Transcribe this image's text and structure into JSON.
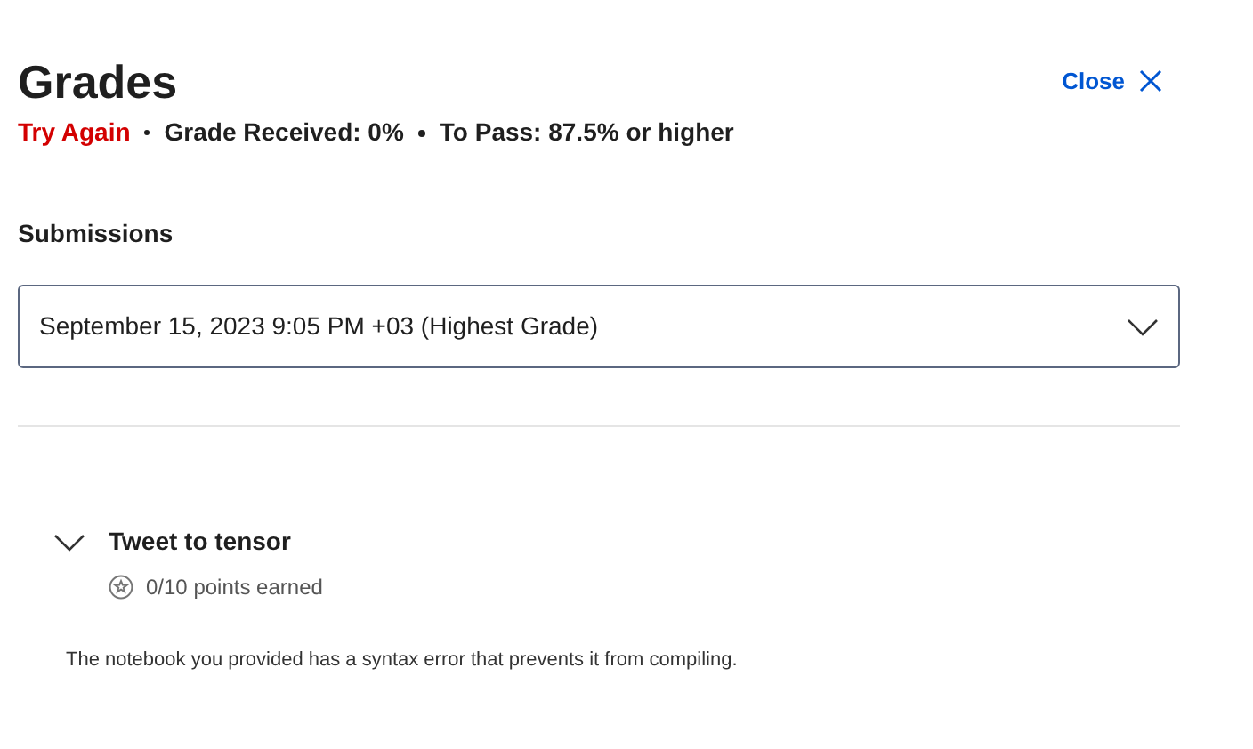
{
  "header": {
    "title": "Grades",
    "close_label": "Close"
  },
  "status": {
    "result": "Try Again",
    "grade_received": "Grade Received: 0%",
    "to_pass": "To Pass: 87.5% or higher"
  },
  "submissions": {
    "label": "Submissions",
    "selected_value": "September 15, 2023 9:05 PM +03 (Highest Grade)"
  },
  "items": [
    {
      "title": "Tweet to tensor",
      "points": "0/10 points earned",
      "expanded": true,
      "feedback": "The notebook you provided has a syntax error that prevents it from compiling."
    }
  ]
}
